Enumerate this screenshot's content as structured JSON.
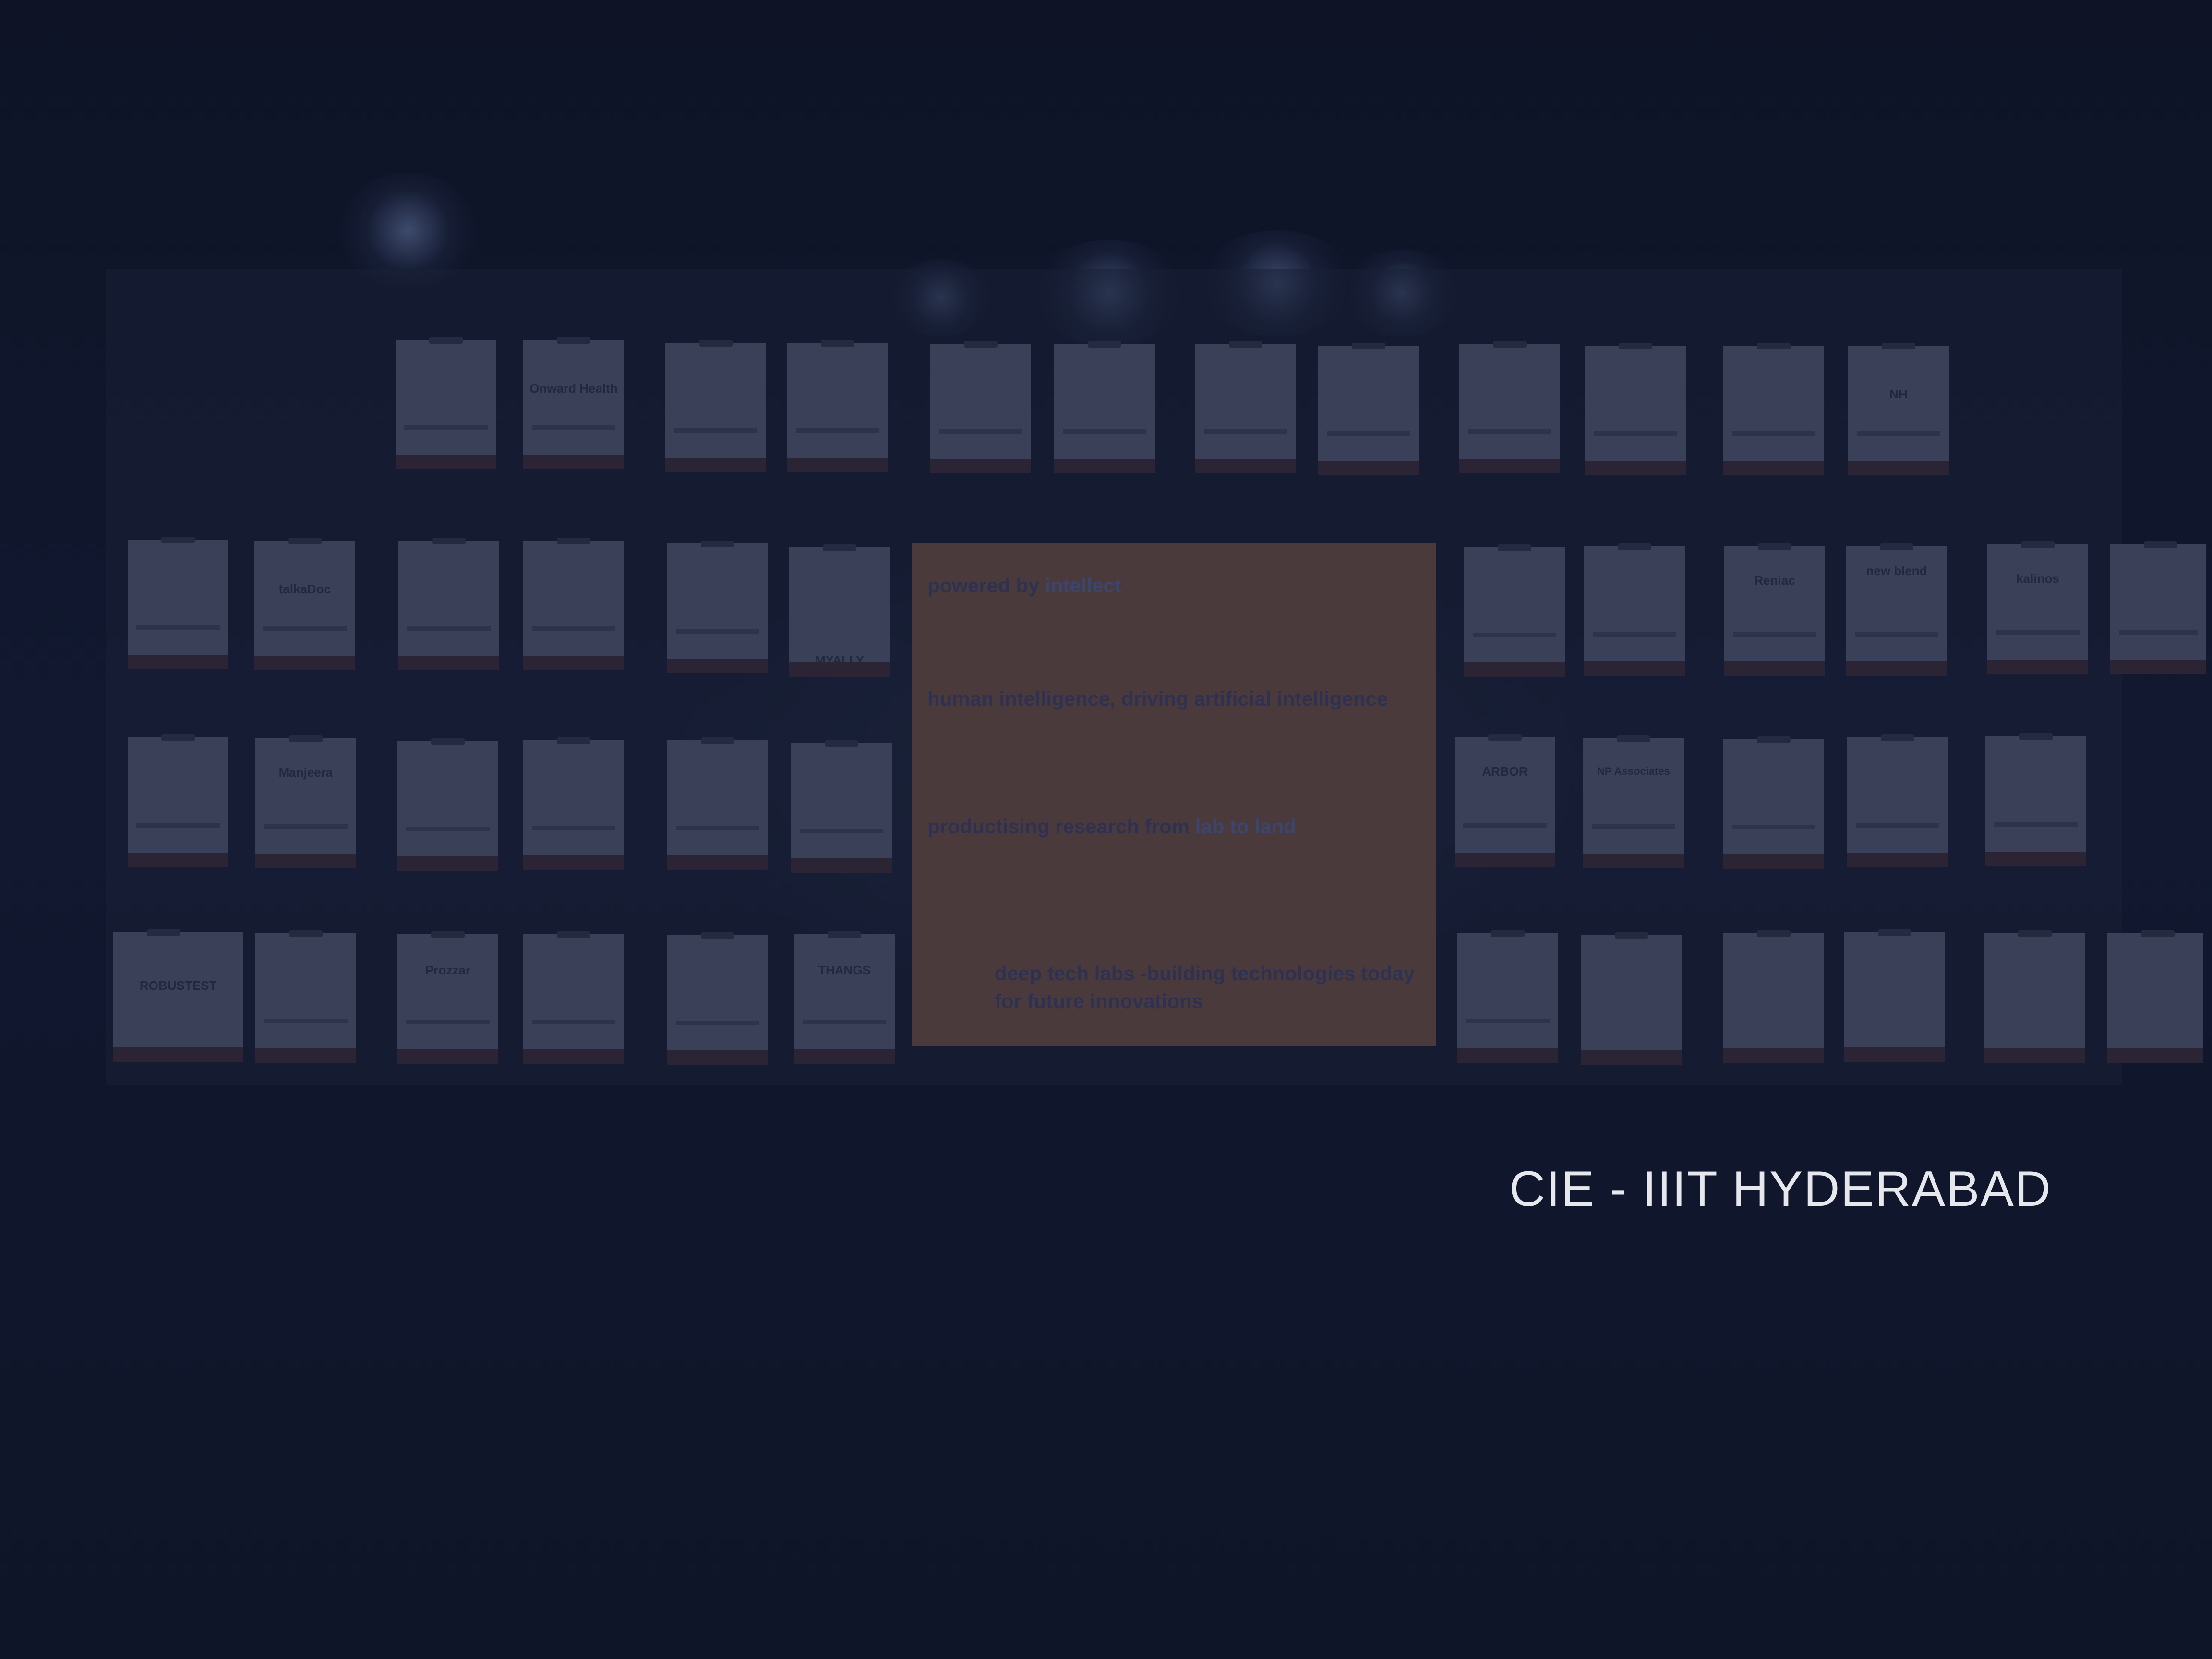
{
  "scene": {
    "background_color": "#0f1528",
    "card_color": "#3a4057",
    "panel_color": "#4a3a3c"
  },
  "panel": {
    "line1_a": "powered by",
    "line1_b": "intellect",
    "line2": "human intelligence, driving artificial intelligence",
    "line3_a": "productising research from",
    "line3_b": "lab to land",
    "line4_a": "deep tech labs -building technologies today",
    "line4_b": "for future innovations"
  },
  "cards": {
    "onward_health": "Onward Health",
    "talkdoc": "talkaDoc",
    "myally": "MYALLY",
    "manjeera": "Manjeera",
    "robustest": "ROBUSTEST",
    "prozzar": "Prozzar",
    "thangs": "THANGS",
    "reniac": "Reniac",
    "new_blend": "new blend",
    "kalinos": "kalinos",
    "np_associates": "NP Associates",
    "arbor": "ARBOR",
    "nh": "NH"
  },
  "caption": {
    "text": "CIE - IIIT HYDERABAD"
  }
}
